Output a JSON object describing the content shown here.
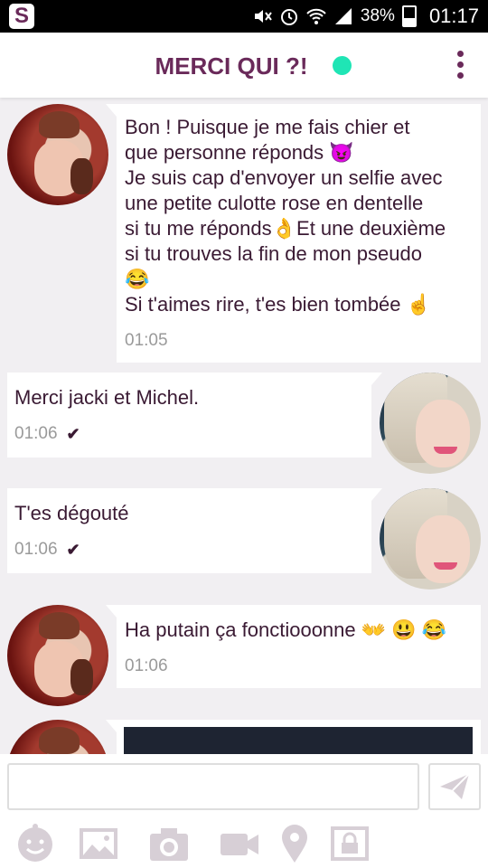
{
  "status_bar": {
    "app_badge": "S",
    "battery_pct": "38%",
    "battery_level": 0.38,
    "time": "01:17"
  },
  "header": {
    "title": "MERCI QUI ?!",
    "online_color": "#1fe5b5",
    "accent_color": "#6a2a5a"
  },
  "messages": [
    {
      "direction": "incoming",
      "text": "Bon ! Puisque je me fais chier et\nque personne réponds 😈\nJe suis cap d'envoyer un selfie avec\nune petite culotte rose en dentelle\nsi tu me réponds👌Et une deuxième\nsi tu trouves la fin de mon pseudo\n😂\nSi t'aimes rire, t'es bien tombée ☝",
      "time": "01:05"
    },
    {
      "direction": "outgoing",
      "text": "Merci jacki et Michel.",
      "time": "01:06",
      "status_icon": "check-icon"
    },
    {
      "direction": "outgoing",
      "text": "T'es dégouté",
      "time": "01:06",
      "status_icon": "check-icon"
    },
    {
      "direction": "incoming",
      "text": "Ha putain ça fonctiooonne 👐 😃 😂",
      "time": "01:06"
    }
  ],
  "composer": {
    "placeholder": "",
    "icons": [
      "emoji-face-icon",
      "gallery-icon",
      "camera-icon",
      "video-icon",
      "location-icon",
      "private-photo-lock-icon"
    ],
    "send_icon": "send-icon"
  }
}
